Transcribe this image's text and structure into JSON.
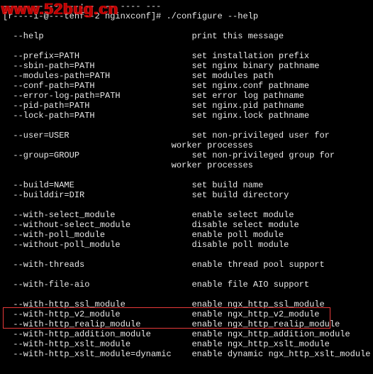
{
  "prompt": {
    "line0": "----- -- --  --:--  -- ---- ---",
    "line1": "[r----i-@---tehf--2 nginxconf]# ./configure --help"
  },
  "options": [
    {
      "flag": "--help",
      "desc": "print this message",
      "lead": 1
    },
    {
      "flag": "--prefix=PATH",
      "desc": "set installation prefix",
      "lead": 1
    },
    {
      "flag": "--sbin-path=PATH",
      "desc": "set nginx binary pathname"
    },
    {
      "flag": "--modules-path=PATH",
      "desc": "set modules path"
    },
    {
      "flag": "--conf-path=PATH",
      "desc": "set nginx.conf pathname"
    },
    {
      "flag": "--error-log-path=PATH",
      "desc": "set error log pathname"
    },
    {
      "flag": "--pid-path=PATH",
      "desc": "set nginx.pid pathname"
    },
    {
      "flag": "--lock-path=PATH",
      "desc": "set nginx.lock pathname"
    },
    {
      "flag": "--user=USER",
      "desc": "set non-privileged user for",
      "lead": 1
    },
    {
      "flag": "",
      "desc": "worker processes",
      "cont": true
    },
    {
      "flag": "--group=GROUP",
      "desc": "set non-privileged group for"
    },
    {
      "flag": "",
      "desc": "worker processes",
      "cont": true
    },
    {
      "flag": "--build=NAME",
      "desc": "set build name",
      "lead": 1
    },
    {
      "flag": "--builddir=DIR",
      "desc": "set build directory"
    },
    {
      "flag": "--with-select_module",
      "desc": "enable select module",
      "lead": 1
    },
    {
      "flag": "--without-select_module",
      "desc": "disable select module"
    },
    {
      "flag": "--with-poll_module",
      "desc": "enable poll module"
    },
    {
      "flag": "--without-poll_module",
      "desc": "disable poll module"
    },
    {
      "flag": "--with-threads",
      "desc": "enable thread pool support",
      "lead": 1
    },
    {
      "flag": "--with-file-aio",
      "desc": "enable file AIO support",
      "lead": 1
    },
    {
      "flag": "--with-http_ssl_module",
      "desc": "enable ngx_http_ssl_module",
      "lead": 1
    },
    {
      "flag": "--with-http_v2_module",
      "desc": "enable ngx_http_v2_module"
    },
    {
      "flag": "--with-http_realip_module",
      "desc": "enable ngx_http_realip_module"
    },
    {
      "flag": "--with-http_addition_module",
      "desc": "enable ngx_http_addition_module"
    },
    {
      "flag": "--with-http_xslt_module",
      "desc": "enable ngx_http_xslt_module"
    },
    {
      "flag": "--with-http_xslt_module=dynamic",
      "desc": "enable dynamic ngx_http_xslt_module"
    }
  ],
  "layout": {
    "indent": 2,
    "flag_col_width": 35,
    "cont_indent": 33
  },
  "watermark": "www.52bug.cn",
  "highlight": {
    "start_flag": "--with-http_ssl_module",
    "end_flag": "--with-http_v2_module"
  }
}
